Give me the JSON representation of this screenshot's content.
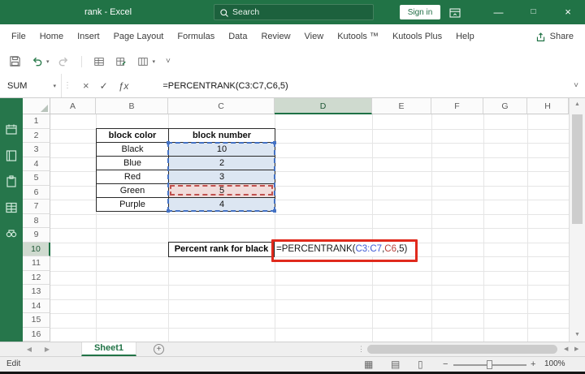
{
  "title_bar": {
    "title": "rank - Excel",
    "search_placeholder": "Search",
    "sign_in_label": "Sign in"
  },
  "menu": {
    "tabs": [
      "File",
      "Home",
      "Insert",
      "Page Layout",
      "Formulas",
      "Data",
      "Review",
      "View",
      "Kutools ™",
      "Kutools Plus",
      "Help"
    ],
    "share_label": "Share"
  },
  "formula_bar": {
    "name_box_value": "SUM",
    "fx_label": "ƒx",
    "formula": "=PERCENTRANK(C3:C7,C6,5)"
  },
  "grid": {
    "column_headers": [
      "A",
      "B",
      "C",
      "D",
      "E",
      "F",
      "G",
      "H"
    ],
    "row_headers": [
      "1",
      "2",
      "3",
      "4",
      "5",
      "6",
      "7",
      "8",
      "9",
      "10",
      "11",
      "12",
      "13",
      "14",
      "15",
      "16"
    ],
    "selected_column": "D",
    "selected_row": "10"
  },
  "cells": {
    "table_headers": [
      "block color",
      "block number"
    ],
    "table_rows": [
      [
        "Black",
        "10"
      ],
      [
        "Blue",
        "2"
      ],
      [
        "Red",
        "3"
      ],
      [
        "Green",
        "5"
      ],
      [
        "Purple",
        "4"
      ]
    ],
    "result_label": "Percent rank for black",
    "formula_parts": [
      {
        "text": "=PERCENTRANK(",
        "color": "#1a1a1a"
      },
      {
        "text": "C3:C7",
        "color": "#3f5bd5"
      },
      {
        "text": ",",
        "color": "#1a1a1a"
      },
      {
        "text": "C6",
        "color": "#b8413a"
      },
      {
        "text": ",5)",
        "color": "#1a1a1a"
      }
    ]
  },
  "sheet_bar": {
    "tabs": [
      {
        "label": "Sheet1",
        "active": true
      }
    ]
  },
  "status_bar": {
    "mode": "Edit",
    "zoom_label": "100%"
  },
  "colors": {
    "accent_green": "#217346",
    "range_fill_blue": "#dce6f2",
    "range_border_blue": "#4472c4",
    "cell_fill_red": "#f1dcdb",
    "cell_border_red": "#c0504d",
    "annotation_red": "#e02a1d"
  },
  "glyphs": {
    "minimize": "—",
    "maximize": "□",
    "close": "×",
    "cancel": "×",
    "enter": "✓",
    "caret_down": "▾",
    "dots": "⋮",
    "expand": "˅",
    "prev": "◀",
    "next": "▶",
    "add": "+",
    "up": "▲",
    "down": "▼",
    "minus": "−",
    "plus": "+",
    "view_normal": "▦",
    "view_layout": "▤",
    "view_break": "▯"
  }
}
